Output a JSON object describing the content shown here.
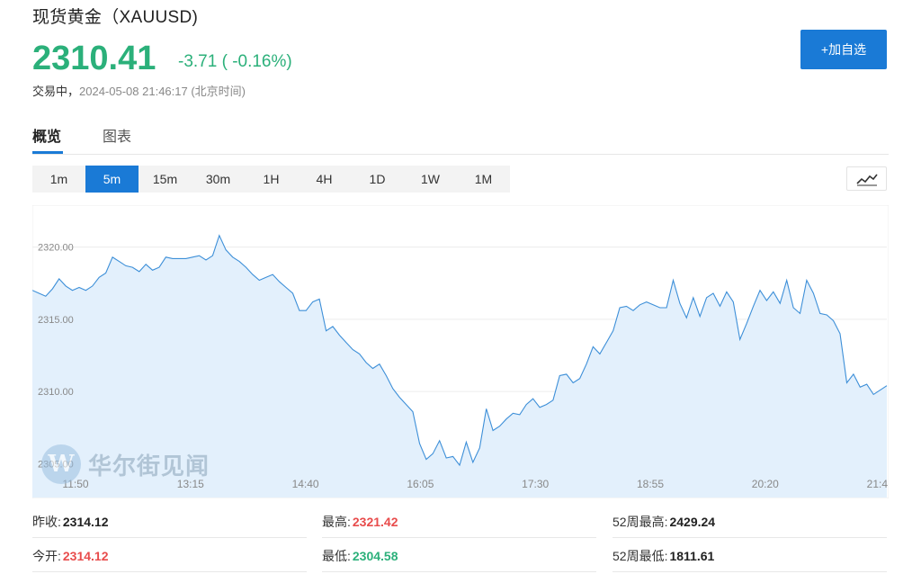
{
  "header": {
    "title": "现货黄金（XAUUSD)",
    "price": "2310.41",
    "change": "-3.71 ( -0.16%)",
    "status_label": "交易中，",
    "timestamp": "2024-05-08 21:46:17 (北京时间)",
    "add_button_label": "+加自选"
  },
  "tabs": [
    {
      "label": "概览",
      "active": true
    },
    {
      "label": "图表",
      "active": false
    }
  ],
  "ranges": [
    {
      "label": "1m",
      "active": false
    },
    {
      "label": "5m",
      "active": true
    },
    {
      "label": "15m",
      "active": false
    },
    {
      "label": "30m",
      "active": false
    },
    {
      "label": "1H",
      "active": false
    },
    {
      "label": "4H",
      "active": false
    },
    {
      "label": "1D",
      "active": false
    },
    {
      "label": "1W",
      "active": false
    },
    {
      "label": "1M",
      "active": false
    }
  ],
  "chart_type_icon": "line-chart-icon",
  "watermark": {
    "logo_letter": "W",
    "text": "华尔街见闻"
  },
  "chart_data": {
    "type": "area",
    "y_ticks": [
      "2320.00",
      "2315.00",
      "2310.00",
      "2305.00"
    ],
    "y_tick_values": [
      2320,
      2315,
      2310,
      2305
    ],
    "x_ticks": [
      "11:50",
      "13:15",
      "14:40",
      "16:05",
      "17:30",
      "18:55",
      "20:20",
      "21:4"
    ],
    "ylim": [
      2302.6,
      2322.9
    ],
    "grid": true,
    "line_color": "#3d8fd8",
    "fill_color": "#e3f0fc",
    "values": [
      2317.0,
      2316.8,
      2316.6,
      2317.1,
      2317.8,
      2317.3,
      2317.0,
      2317.2,
      2317.0,
      2317.3,
      2317.9,
      2318.2,
      2319.3,
      2319.0,
      2318.7,
      2318.6,
      2318.3,
      2318.8,
      2318.4,
      2318.6,
      2319.3,
      2319.2,
      2319.2,
      2319.2,
      2319.3,
      2319.4,
      2319.1,
      2319.4,
      2320.8,
      2319.8,
      2319.3,
      2319.0,
      2318.6,
      2318.1,
      2317.7,
      2317.9,
      2318.1,
      2317.6,
      2317.2,
      2316.8,
      2315.6,
      2315.6,
      2316.2,
      2316.4,
      2314.2,
      2314.5,
      2313.9,
      2313.4,
      2312.9,
      2312.6,
      2312.0,
      2311.6,
      2311.9,
      2311.1,
      2310.2,
      2309.6,
      2309.1,
      2308.6,
      2306.4,
      2305.3,
      2305.7,
      2306.6,
      2305.4,
      2305.5,
      2304.9,
      2306.5,
      2305.1,
      2306.1,
      2308.8,
      2307.3,
      2307.6,
      2308.1,
      2308.5,
      2308.4,
      2309.1,
      2309.5,
      2308.9,
      2309.1,
      2309.4,
      2311.1,
      2311.2,
      2310.6,
      2310.9,
      2311.9,
      2313.1,
      2312.6,
      2313.4,
      2314.2,
      2315.8,
      2315.9,
      2315.6,
      2316.0,
      2316.2,
      2316.0,
      2315.8,
      2315.8,
      2317.7,
      2316.1,
      2315.1,
      2316.5,
      2315.2,
      2316.5,
      2316.8,
      2315.9,
      2316.9,
      2316.2,
      2313.6,
      2314.7,
      2315.9,
      2317.0,
      2316.3,
      2316.9,
      2316.1,
      2317.7,
      2315.8,
      2315.4,
      2317.7,
      2316.8,
      2315.4,
      2315.3,
      2314.9,
      2314.0,
      2310.6,
      2311.2,
      2310.3,
      2310.5,
      2309.8,
      2310.1,
      2310.4
    ]
  },
  "stats": [
    {
      "label": "昨收:",
      "value": "2314.12",
      "tone": "neutral"
    },
    {
      "label": "最高:",
      "value": "2321.42",
      "tone": "up"
    },
    {
      "label": "52周最高:",
      "value": "2429.24",
      "tone": "neutral"
    },
    {
      "label": "今开:",
      "value": "2314.12",
      "tone": "up"
    },
    {
      "label": "最低:",
      "value": "2304.58",
      "tone": "down"
    },
    {
      "label": "52周最低:",
      "value": "1811.61",
      "tone": "neutral"
    }
  ]
}
